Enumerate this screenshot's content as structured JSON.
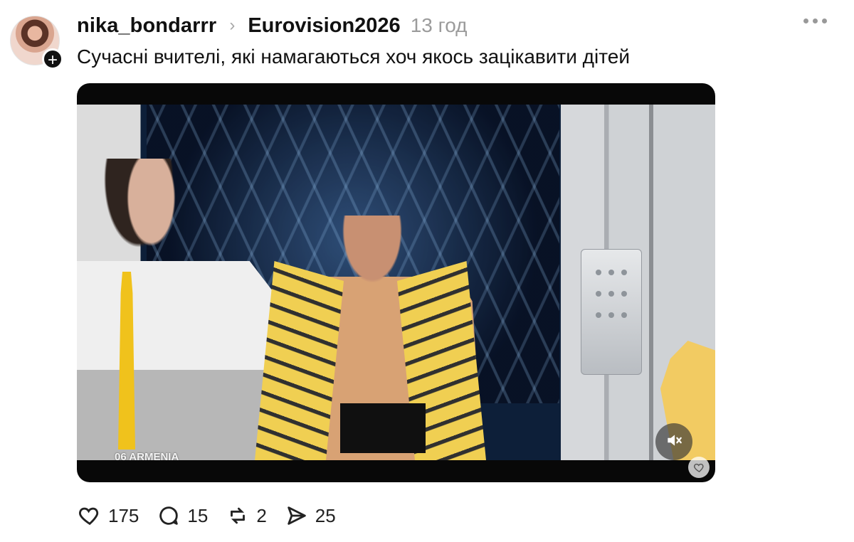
{
  "post": {
    "username": "nika_bondarrr",
    "topic": "Eurovision2026",
    "time": "13 год",
    "text": "Сучасні вчителі, які намагаються хоч якось зацікавити дітей"
  },
  "header_icons": {
    "chevron": "›",
    "more": "more-horizontal-icon",
    "follow": "plus-icon"
  },
  "media": {
    "overlay_text": "06 ARMENIA"
  },
  "actions": {
    "likes": "175",
    "comments": "15",
    "reposts": "2",
    "shares": "25"
  },
  "icon_semantics": {
    "like": "heart-icon",
    "comment": "comment-bubble-icon",
    "repost": "repost-icon",
    "share": "send-icon",
    "mute": "mute-speaker-icon"
  }
}
